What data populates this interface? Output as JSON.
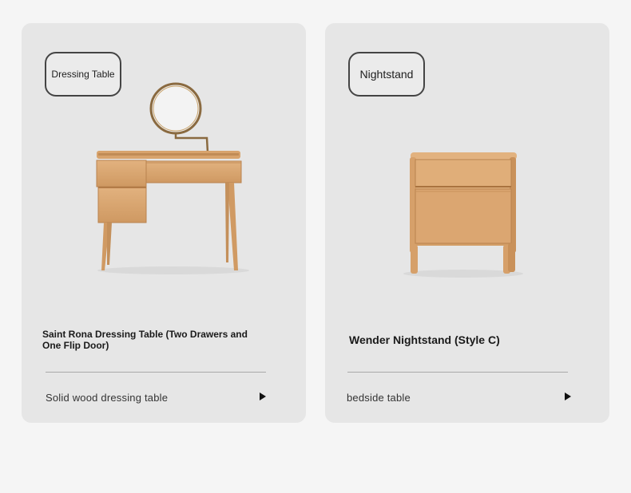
{
  "cards": [
    {
      "badge": "Dressing Table",
      "title": "Saint Rona Dressing Table (Two Drawers and One Flip Door)",
      "subtitle": "Solid wood dressing table",
      "image_icon": "dressing-table-with-mirror"
    },
    {
      "badge": "Nightstand",
      "title": "Wender Nightstand (Style C)",
      "subtitle": "bedside table",
      "image_icon": "nightstand-drawer-cabinet"
    }
  ],
  "colors": {
    "page_bg": "#f5f5f5",
    "card_bg": "#e6e6e6",
    "wood": "#d9a574",
    "wood_dark": "#b9834f"
  }
}
